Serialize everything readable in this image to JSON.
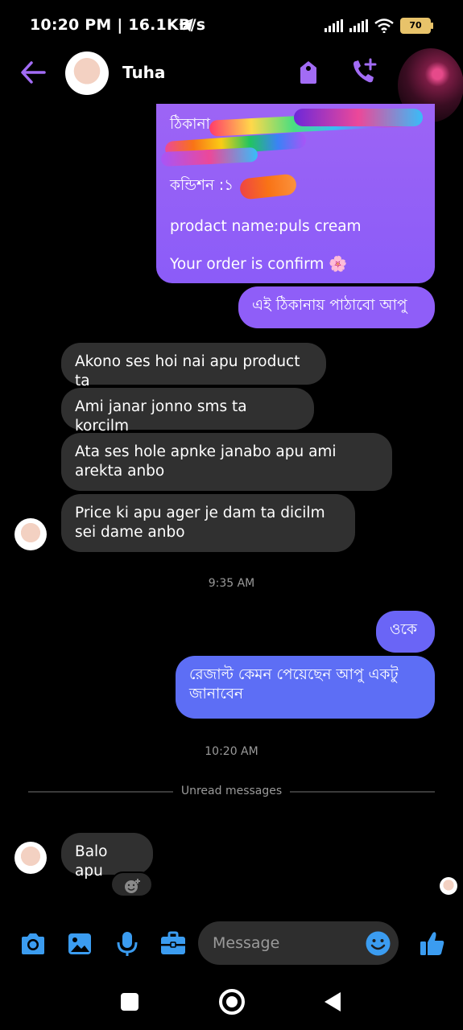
{
  "status_bar": {
    "time": "10:20 PM | 16.1KB/s",
    "battery": "70"
  },
  "header": {
    "contact_name": "Tuha"
  },
  "messages": {
    "order_card": {
      "address_label": "ঠিকানা",
      "condition_label": "কন্ডিশন :১",
      "product_line": "prodact name:puls cream",
      "confirm_line": "Your order is confirm 🌸"
    },
    "out_1": "এই ঠিকানায় পাঠাবো আপু",
    "in_1": "Akono ses hoi nai apu product ta",
    "in_2": "Ami janar jonno sms ta korcilm",
    "in_3": "Ata ses hole apnke janabo apu ami arekta anbo",
    "in_4": "Price ki apu  ager je dam ta dicilm sei dame anbo",
    "time_1": "9:35 AM",
    "out_2": "ওকে",
    "out_3": "রেজাল্ট কেমন পেয়েছেন আপু একটু জানাবেন",
    "time_2": "10:20 AM",
    "unread_label": "Unread messages",
    "in_5": "Balo apu"
  },
  "composer": {
    "placeholder": "Message"
  },
  "colors": {
    "accent": "#a26cf5",
    "outgoing_bubble": "#7a5cf9",
    "outgoing_bubble_blue": "#5d6ef5",
    "incoming_bubble": "#303030",
    "composer_icon": "#3b9cf0"
  }
}
